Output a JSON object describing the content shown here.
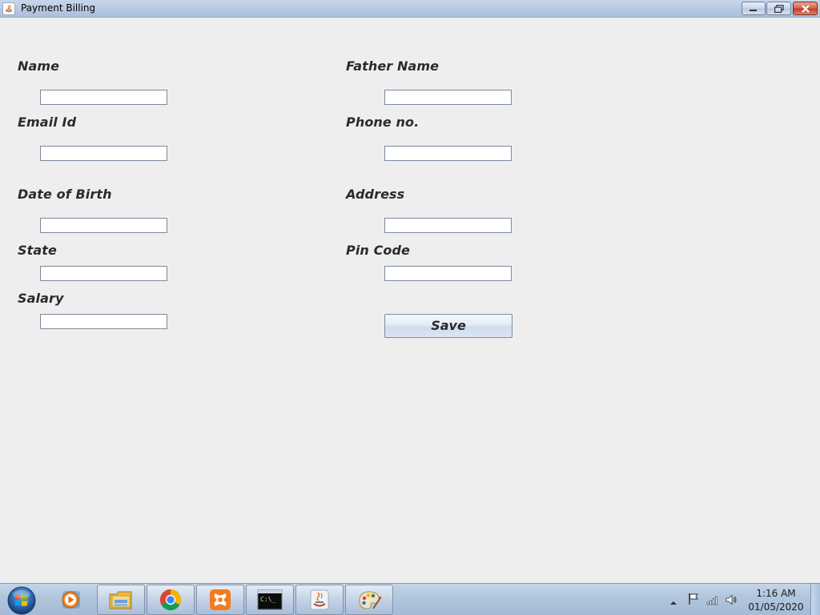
{
  "window": {
    "title": "Payment Billing",
    "icon": "java-icon",
    "controls": [
      "minimize",
      "restore",
      "close"
    ]
  },
  "form": {
    "left": [
      {
        "label": "Name",
        "value": ""
      },
      {
        "label": "Email Id",
        "value": ""
      },
      {
        "label": "Date of Birth",
        "value": ""
      },
      {
        "label": "State",
        "value": ""
      },
      {
        "label": "Salary",
        "value": ""
      }
    ],
    "right": [
      {
        "label": "Father Name",
        "value": ""
      },
      {
        "label": "Phone no.",
        "value": ""
      },
      {
        "label": "Address",
        "value": ""
      },
      {
        "label": "Pin Code",
        "value": ""
      }
    ],
    "save_label": "Save"
  },
  "taskbar": {
    "items": [
      {
        "name": "windows-media-player-icon"
      },
      {
        "name": "file-explorer-icon"
      },
      {
        "name": "chrome-icon"
      },
      {
        "name": "xampp-icon"
      },
      {
        "name": "command-prompt-icon",
        "glyph": "C:\\_"
      },
      {
        "name": "java-icon"
      },
      {
        "name": "paint-icon"
      }
    ],
    "tray": [
      "show-hidden-icons-icon",
      "action-center-flag-icon",
      "network-signal-icon",
      "volume-icon"
    ],
    "clock": {
      "time": "1:16 AM",
      "date": "01/05/2020"
    }
  },
  "colors": {
    "background": "#eeeeee",
    "label": "#2b2b2b",
    "close_button": "#c4391e",
    "titlebar": "#b9cbe3"
  }
}
